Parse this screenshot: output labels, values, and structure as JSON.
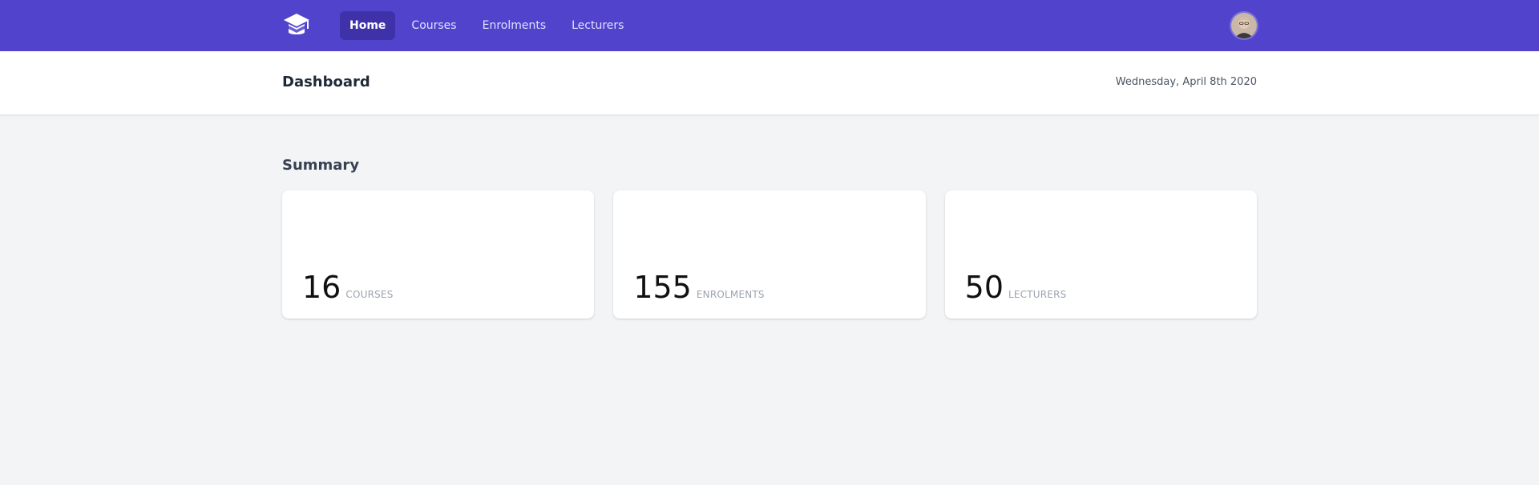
{
  "nav": {
    "links": [
      {
        "label": "Home",
        "active": true
      },
      {
        "label": "Courses",
        "active": false
      },
      {
        "label": "Enrolments",
        "active": false
      },
      {
        "label": "Lecturers",
        "active": false
      }
    ],
    "logo_icon": "graduation-cap-icon",
    "avatar_icon": "user-avatar"
  },
  "header": {
    "title": "Dashboard",
    "date": "Wednesday, April 8th 2020"
  },
  "summary": {
    "title": "Summary",
    "cards": [
      {
        "value": "16",
        "label": "COURSES"
      },
      {
        "value": "155",
        "label": "ENROLMENTS"
      },
      {
        "value": "50",
        "label": "LECTURERS"
      }
    ]
  },
  "colors": {
    "nav_bg": "#5243cc",
    "nav_active_bg": "#3f32a8",
    "page_bg": "#f3f4f6",
    "card_bg": "#ffffff"
  }
}
